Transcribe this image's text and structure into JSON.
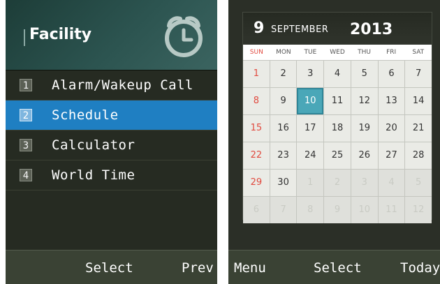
{
  "left_screen": {
    "title": "Facility",
    "menu": [
      {
        "num": "1",
        "label": "Alarm/Wakeup Call",
        "selected": false
      },
      {
        "num": "2",
        "label": "Schedule",
        "selected": true
      },
      {
        "num": "3",
        "label": "Calculator",
        "selected": false
      },
      {
        "num": "4",
        "label": "World Time",
        "selected": false
      }
    ],
    "softkeys": {
      "center": "Select",
      "right": "Prev"
    }
  },
  "right_screen": {
    "header": {
      "day": "9",
      "month": "SEPTEMBER",
      "year": "2013"
    },
    "weekdays": [
      "SUN",
      "MON",
      "TUE",
      "WED",
      "THU",
      "FRI",
      "SAT"
    ],
    "weeks": [
      [
        "1",
        "2",
        "3",
        "4",
        "5",
        "6",
        "7"
      ],
      [
        "8",
        "9",
        "10",
        "11",
        "12",
        "13",
        "14"
      ],
      [
        "15",
        "16",
        "17",
        "18",
        "19",
        "20",
        "21"
      ],
      [
        "22",
        "23",
        "24",
        "25",
        "26",
        "27",
        "28"
      ],
      [
        "29",
        "30",
        "1",
        "2",
        "3",
        "4",
        "5"
      ],
      [
        "6",
        "7",
        "8",
        "9",
        "10",
        "11",
        "12"
      ]
    ],
    "selected_date": "10",
    "softkeys": {
      "left": "Menu",
      "center": "Select",
      "right": "Today"
    }
  },
  "colors": {
    "selection": "#1f7fc2",
    "today": "#4aa7b8",
    "sunday": "#e14a3f"
  },
  "icons": {
    "header": "alarm-clock-icon"
  }
}
